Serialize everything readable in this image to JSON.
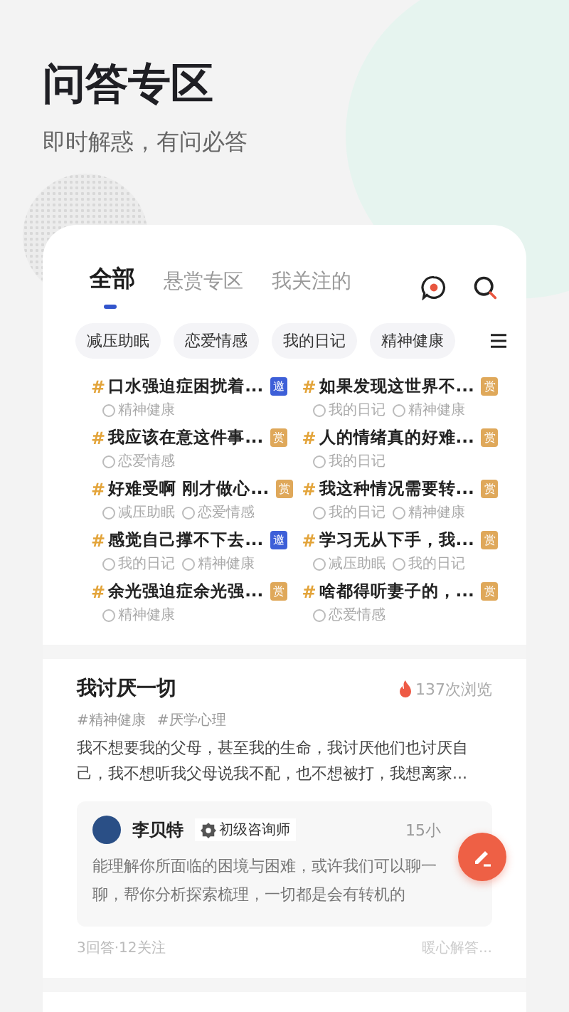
{
  "header": {
    "title": "问答专区",
    "subtitle": "即时解惑，有问必答"
  },
  "tabs": [
    {
      "label": "全部",
      "selected": true
    },
    {
      "label": "悬赏专区",
      "selected": false
    },
    {
      "label": "我关注的",
      "selected": false
    }
  ],
  "chips": [
    "减压助眠",
    "恋爱情感",
    "我的日记",
    "精神健康"
  ],
  "questions": [
    {
      "mark": "#",
      "title": "口水强迫症困扰着...",
      "badge": "邀",
      "kind": "invite",
      "tags": [
        "精神健康"
      ]
    },
    {
      "mark": "#",
      "title": "如果发现这世界不...",
      "badge": "赏",
      "kind": "reward",
      "tags": [
        "我的日记",
        "精神健康"
      ]
    },
    {
      "mark": "#",
      "title": "我应该在意这件事...",
      "badge": "赏",
      "kind": "reward",
      "tags": [
        "恋爱情感"
      ]
    },
    {
      "mark": "#",
      "title": "人的情绪真的好难...",
      "badge": "赏",
      "kind": "reward",
      "tags": [
        "我的日记"
      ]
    },
    {
      "mark": "#",
      "title": "好难受啊 刚才做心...",
      "badge": "赏",
      "kind": "reward",
      "tags": [
        "减压助眠",
        "恋爱情感"
      ]
    },
    {
      "mark": "#",
      "title": "我这种情况需要转...",
      "badge": "赏",
      "kind": "reward",
      "tags": [
        "我的日记",
        "精神健康"
      ]
    },
    {
      "mark": "#",
      "title": "感觉自己撑不下去...",
      "badge": "邀",
      "kind": "invite",
      "tags": [
        "我的日记",
        "精神健康"
      ]
    },
    {
      "mark": "#",
      "title": "学习无从下手，我...",
      "badge": "赏",
      "kind": "reward",
      "tags": [
        "减压助眠",
        "我的日记"
      ]
    },
    {
      "mark": "#",
      "title": "余光强迫症余光强...",
      "badge": "赏",
      "kind": "reward",
      "tags": [
        "精神健康"
      ]
    },
    {
      "mark": "#",
      "title": "啥都得听妻子的，...",
      "badge": "赏",
      "kind": "reward",
      "tags": [
        "恋爱情感"
      ]
    }
  ],
  "post": {
    "title": "我讨厌一切",
    "views": "137次浏览",
    "tags": [
      "#精神健康",
      "#厌学心理"
    ],
    "body": "我不想要我的父母，甚至我的生命，我讨厌他们也讨厌自己，我不想听我父母说我不配，也不想被打，我想离家...",
    "answer": {
      "author": "李贝特",
      "level": "初级咨询师",
      "time": "15小",
      "text": "能理解你所面临的困境与困难，或许我们可以聊一聊，帮你分析探索梳理，一切都是会有转机的"
    },
    "stats": "3回答·12关注",
    "action": "暖心解答..."
  }
}
